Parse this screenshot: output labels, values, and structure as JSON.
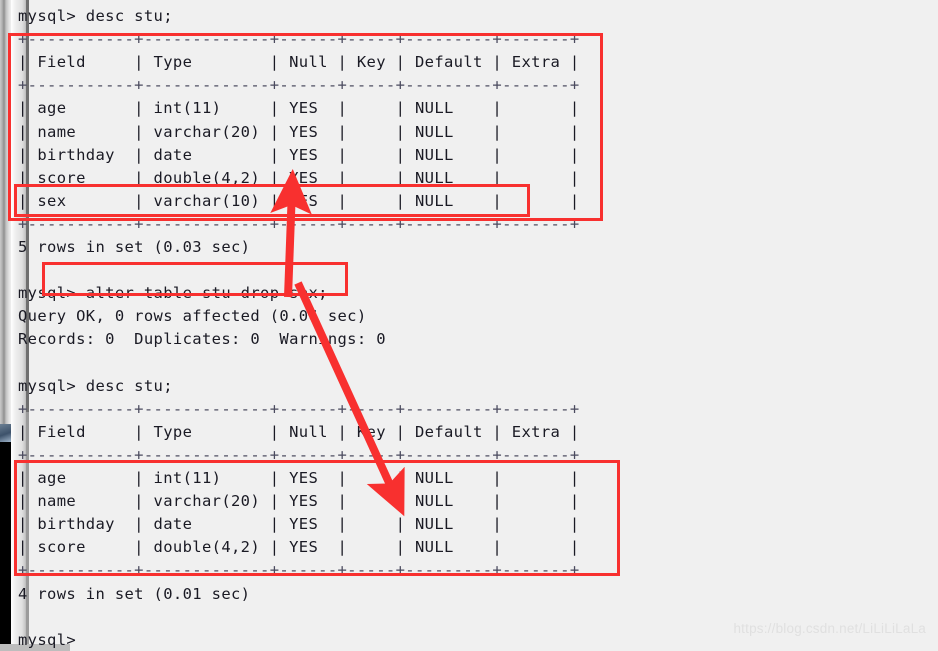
{
  "terminal": {
    "background_color": "#f0f0f0",
    "text_color": "#1a1a24",
    "annotation_color": "#f8302f",
    "lines": [
      "mysql> desc stu;",
      "+-----------+-------------+------+-----+---------+-------+",
      "| Field     | Type        | Null | Key | Default | Extra |",
      "+-----------+-------------+------+-----+---------+-------+",
      "| age       | int(11)     | YES  |     | NULL    |       |",
      "| name      | varchar(20) | YES  |     | NULL    |       |",
      "| birthday  | date        | YES  |     | NULL    |       |",
      "| score     | double(4,2) | YES  |     | NULL    |       |",
      "| sex       | varchar(10) | YES  |     | NULL    |       |",
      "+-----------+-------------+------+-----+---------+-------+",
      "5 rows in set (0.03 sec)",
      "",
      "mysql> alter table stu drop sex;",
      "Query OK, 0 rows affected (0.06 sec)",
      "Records: 0  Duplicates: 0  Warnings: 0",
      "",
      "mysql> desc stu;",
      "+-----------+-------------+------+-----+---------+-------+",
      "| Field     | Type        | Null | Key | Default | Extra |",
      "+-----------+-------------+------+-----+---------+-------+",
      "| age       | int(11)     | YES  |     | NULL    |       |",
      "| name      | varchar(20) | YES  |     | NULL    |       |",
      "| birthday  | date        | YES  |     | NULL    |       |",
      "| score     | double(4,2) | YES  |     | NULL    |       |",
      "+-----------+-------------+------+-----+---------+-------+",
      "4 rows in set (0.01 sec)",
      "",
      "mysql>"
    ],
    "prompt": "mysql>",
    "commands": [
      "desc stu;",
      "alter table stu drop sex;",
      "desc stu;"
    ],
    "table_before": {
      "columns": [
        "Field",
        "Type",
        "Null",
        "Key",
        "Default",
        "Extra"
      ],
      "rows": [
        [
          "age",
          "int(11)",
          "YES",
          "",
          "NULL",
          ""
        ],
        [
          "name",
          "varchar(20)",
          "YES",
          "",
          "NULL",
          ""
        ],
        [
          "birthday",
          "date",
          "YES",
          "",
          "NULL",
          ""
        ],
        [
          "score",
          "double(4,2)",
          "YES",
          "",
          "NULL",
          ""
        ],
        [
          "sex",
          "varchar(10)",
          "YES",
          "",
          "NULL",
          ""
        ]
      ],
      "footer": "5 rows in set (0.03 sec)"
    },
    "table_after": {
      "columns": [
        "Field",
        "Type",
        "Null",
        "Key",
        "Default",
        "Extra"
      ],
      "rows": [
        [
          "age",
          "int(11)",
          "YES",
          "",
          "NULL",
          ""
        ],
        [
          "name",
          "varchar(20)",
          "YES",
          "",
          "NULL",
          ""
        ],
        [
          "birthday",
          "date",
          "YES",
          "",
          "NULL",
          ""
        ],
        [
          "score",
          "double(4,2)",
          "YES",
          "",
          "NULL",
          ""
        ]
      ],
      "footer": "4 rows in set (0.01 sec)"
    },
    "query_result": {
      "status": "Query OK, 0 rows affected (0.06 sec)",
      "records": "Records: 0  Duplicates: 0  Warnings: 0"
    }
  },
  "watermark": {
    "text": "https://blog.csdn.net/LiLiLiLaLa"
  }
}
